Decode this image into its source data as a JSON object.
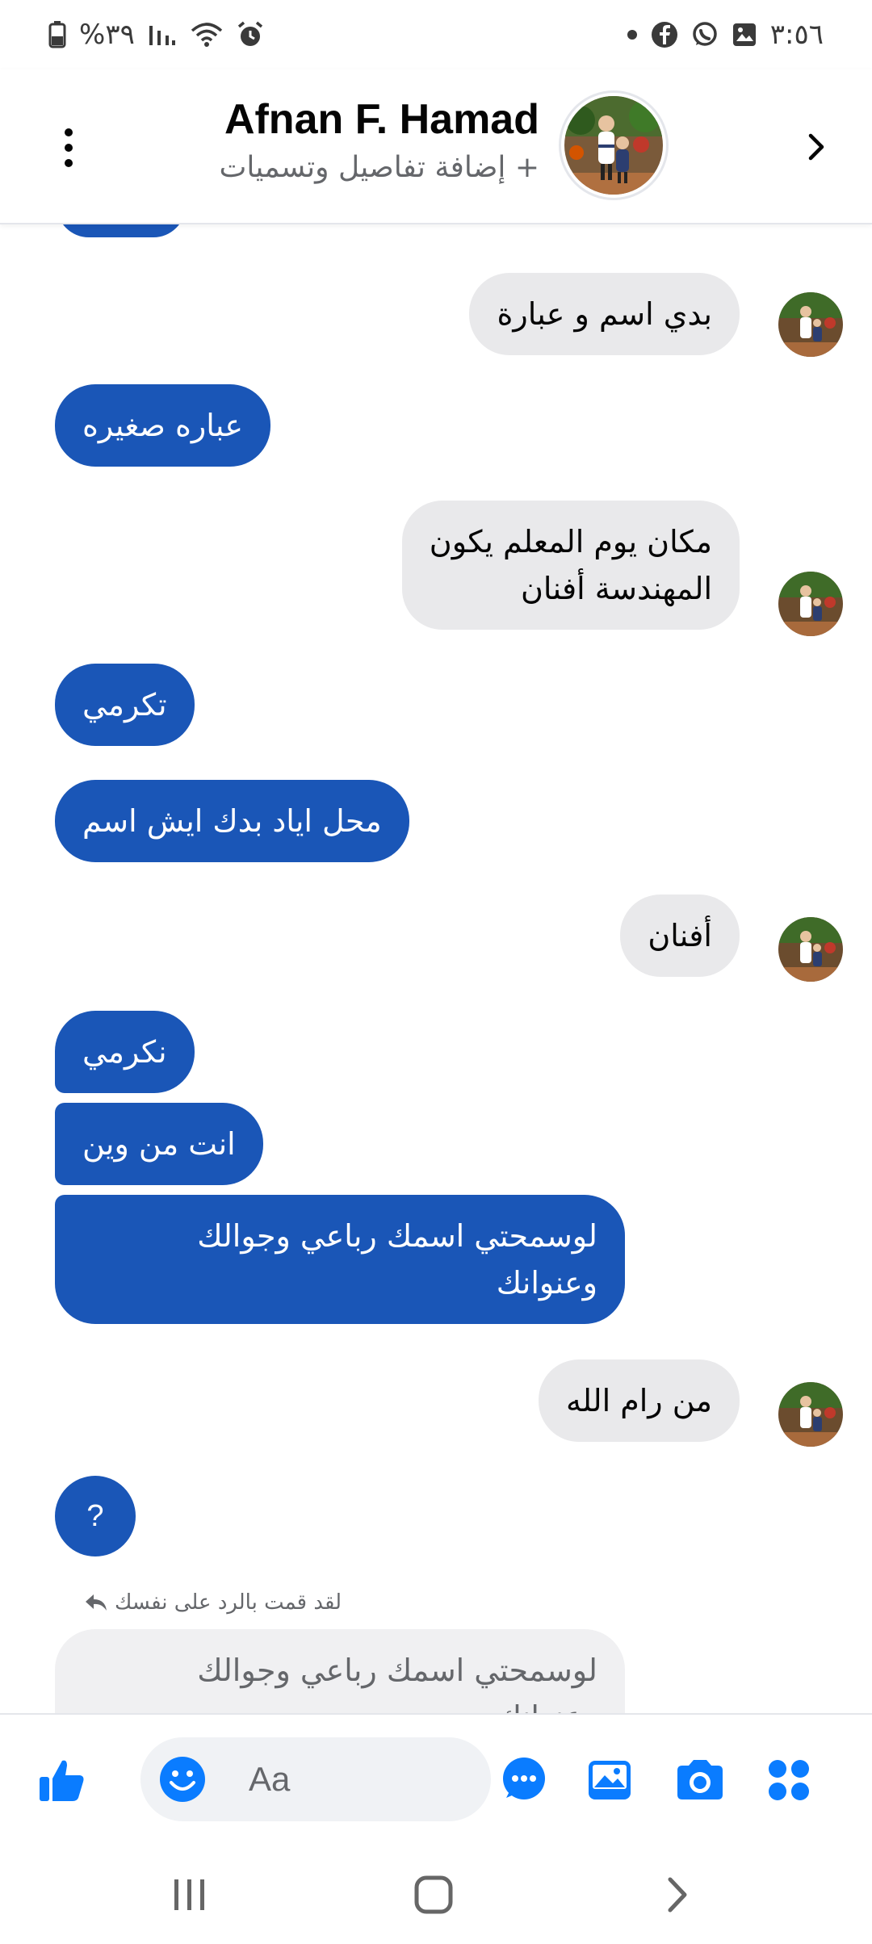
{
  "status_bar": {
    "time": "٣:٥٦",
    "battery": "%٣٩",
    "icons": [
      "dot-icon",
      "facebook-icon",
      "whatsapp-icon",
      "gallery-icon",
      "alarm-icon",
      "wifi-icon",
      "signal-icon",
      "battery-icon"
    ]
  },
  "header": {
    "contact_name": "Afnan F. Hamad",
    "subtitle": "+ إضافة تفاصيل وتسميات"
  },
  "messages": [
    {
      "side": "in",
      "text": "بدي اسم و عبارة"
    },
    {
      "side": "out",
      "text": "عباره صغيره"
    },
    {
      "side": "in",
      "text": "مكان يوم المعلم يكون\nالمهندسة أفنان"
    },
    {
      "side": "out",
      "text": "تكرمي"
    },
    {
      "side": "out",
      "text": "محل اياد بدك ايش اسم"
    },
    {
      "side": "in",
      "text": "أفنان"
    },
    {
      "side": "out",
      "text": "نكرمي"
    },
    {
      "side": "out",
      "text": "انت من وين"
    },
    {
      "side": "out",
      "text": "لوسمحتي اسمك رباعي وجوالك\nوعنوانك"
    },
    {
      "side": "in",
      "text": "من رام الله"
    },
    {
      "side": "out",
      "text": "?"
    }
  ],
  "reply": {
    "label": "لقد قمت بالرد على نفسك",
    "quoted_text": "لوسمحتي اسمك رباعي وجوالك\nوعنوانك"
  },
  "composer": {
    "placeholder": "Aa"
  },
  "colors": {
    "outgoing_bubble": "#1a56b7",
    "incoming_bubble": "#e9e9eb",
    "accent": "#0a7cff"
  }
}
